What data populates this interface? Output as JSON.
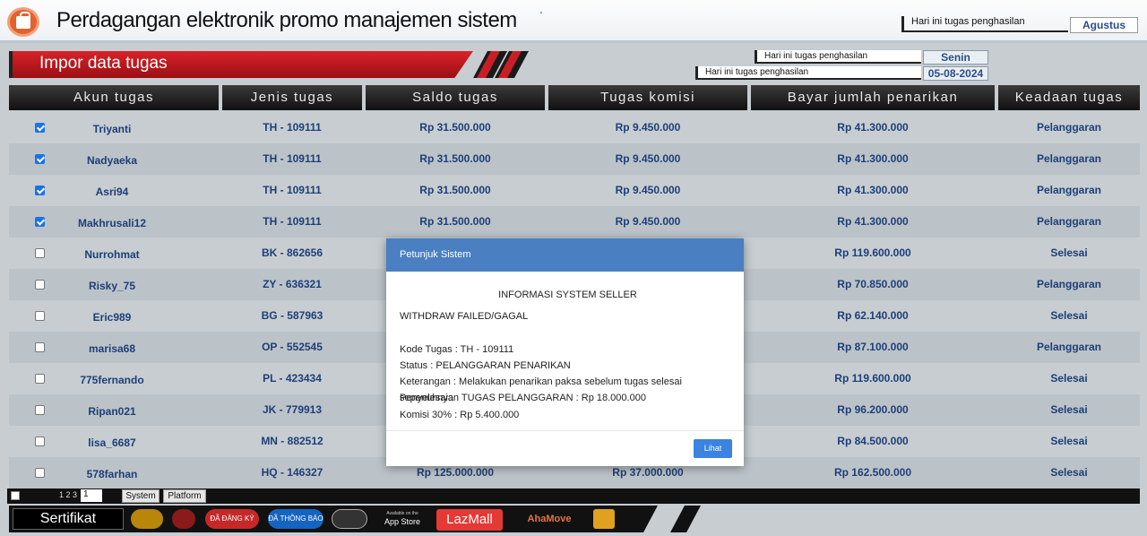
{
  "header": {
    "title": "Perdagangan elektronik promo manajemen sistem",
    "tick": "'",
    "earnings_label": "Hari ini tugas penghasilan",
    "month": "Agustus"
  },
  "banner": {
    "title": "Impor data tugas"
  },
  "info": {
    "row1_label": "Hari ini tugas penghasilan",
    "row1_value": "Senin",
    "row2_label": "Hari ini tugas penghasilan",
    "row2_value": "05-08-2024"
  },
  "table": {
    "headers": [
      "Akun tugas",
      "Jenis tugas",
      "Saldo tugas",
      "Tugas komisi",
      "Bayar jumlah penarikan",
      "Keadaan tugas"
    ],
    "rows": [
      {
        "checked": true,
        "akun": "Triyanti",
        "jenis": "TH - 109111",
        "saldo": "Rp 31.500.000",
        "komisi": "Rp 9.450.000",
        "bayar": "Rp 41.300.000",
        "keadaan": "Pelanggaran"
      },
      {
        "checked": true,
        "akun": "Nadyaeka",
        "jenis": "TH - 109111",
        "saldo": "Rp 31.500.000",
        "komisi": "Rp 9.450.000",
        "bayar": "Rp 41.300.000",
        "keadaan": "Pelanggaran"
      },
      {
        "checked": true,
        "akun": "Asri94",
        "jenis": "TH - 109111",
        "saldo": "Rp 31.500.000",
        "komisi": "Rp 9.450.000",
        "bayar": "Rp 41.300.000",
        "keadaan": "Pelanggaran"
      },
      {
        "checked": true,
        "akun": "Makhrusali12",
        "jenis": "TH - 109111",
        "saldo": "Rp 31.500.000",
        "komisi": "Rp 9.450.000",
        "bayar": "Rp 41.300.000",
        "keadaan": "Pelanggaran"
      },
      {
        "checked": false,
        "akun": "Nurrohmat",
        "jenis": "BK - 862656",
        "saldo": "",
        "komisi": "",
        "bayar": "Rp 119.600.000",
        "keadaan": "Selesai"
      },
      {
        "checked": false,
        "akun": "Risky_75",
        "jenis": "ZY - 636321",
        "saldo": "",
        "komisi": "",
        "bayar": "Rp 70.850.000",
        "keadaan": "Pelanggaran"
      },
      {
        "checked": false,
        "akun": "Eric989",
        "jenis": "BG - 587963",
        "saldo": "",
        "komisi": "",
        "bayar": "Rp 62.140.000",
        "keadaan": "Selesai"
      },
      {
        "checked": false,
        "akun": "marisa68",
        "jenis": "OP - 552545",
        "saldo": "",
        "komisi": "",
        "bayar": "Rp 87.100.000",
        "keadaan": "Pelanggaran"
      },
      {
        "checked": false,
        "akun": "775fernando",
        "jenis": "PL - 423434",
        "saldo": "",
        "komisi": "",
        "bayar": "Rp 119.600.000",
        "keadaan": "Selesai"
      },
      {
        "checked": false,
        "akun": "Ripan021",
        "jenis": "JK - 779913",
        "saldo": "",
        "komisi": "",
        "bayar": "Rp 96.200.000",
        "keadaan": "Selesai"
      },
      {
        "checked": false,
        "akun": "lisa_6687",
        "jenis": "MN - 882512",
        "saldo": "",
        "komisi": "",
        "bayar": "Rp 84.500.000",
        "keadaan": "Selesai"
      },
      {
        "checked": false,
        "akun": "578farhan",
        "jenis": "HQ - 146327",
        "saldo": "Rp 125.000.000",
        "komisi": "Rp 37.000.000",
        "bayar": "Rp 162.500.000",
        "keadaan": "Selesai"
      }
    ]
  },
  "pager": {
    "pages": "1 2 3",
    "selected": "1",
    "system_label": "System",
    "platform_label": "Platform"
  },
  "footer": {
    "cert_label": "Sertifikat",
    "badges": [
      "",
      "",
      "ĐÃ ĐĂNG KÝ",
      "ĐÃ THÔNG BÁO",
      "",
      "App Store",
      "LazMall",
      "AhaMove",
      ""
    ],
    "appstore_small": "Available on the"
  },
  "modal": {
    "title": "Petunjuk Sistem",
    "heading": "INFORMASI SYSTEM SELLER",
    "line1": "WITHDRAW FAILED/GAGAL",
    "kode": "Kode Tugas : TH - 109111",
    "status": "Status : PELANGGARAN PENARIKAN",
    "keterangan": "Keterangan : Melakukan penarikan paksa sebelum tugas selesai sepenuhnya",
    "penyelesaian": "Penyelesaian TUGAS PELANGGARAN : Rp 18.000.000",
    "komisi": "Komisi 30% : Rp 5.400.000",
    "button": "Lihat"
  },
  "colors": {
    "accent": "#4a7fc1",
    "banner": "#c81f25",
    "cell_text": "#1d3f78"
  }
}
